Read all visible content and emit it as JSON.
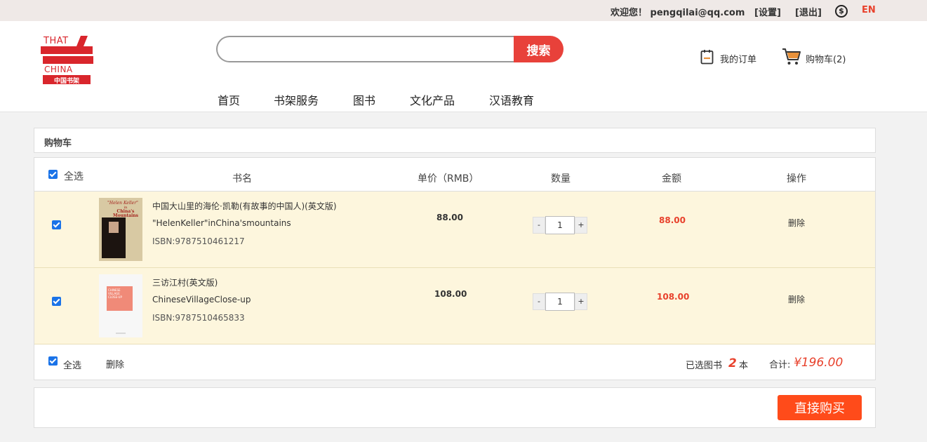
{
  "topbar": {
    "welcome": "欢迎您！ pengqilai@qq.com",
    "settings": "[设置]",
    "logout": "[退出]",
    "currency_icon": "dollar-circle-icon",
    "currency_symbol": "$",
    "language": "EN"
  },
  "logo": {
    "line1": "THAT",
    "line2": "CHINA",
    "line3": "中国书架"
  },
  "search": {
    "placeholder": "",
    "button": "搜索"
  },
  "header_links": {
    "orders": "我的订单",
    "cart": "购物车(2)"
  },
  "nav": [
    "首页",
    "书架服务",
    "图书",
    "文化产品",
    "汉语教育"
  ],
  "cart": {
    "title": "购物车",
    "columns": {
      "select_all": "全选",
      "book": "书名",
      "unit_price": "单价（RMB）",
      "quantity": "数量",
      "amount": "金额",
      "action": "操作"
    },
    "items": [
      {
        "title_cn": "中国大山里的海伦·凯勒(有故事的中国人)(英文版)",
        "title_en": "\"HelenKeller\"inChina'smountains",
        "isbn": "ISBN:9787510461217",
        "price": "88.00",
        "qty": "1",
        "amount": "88.00",
        "action": "删除",
        "cover_text": [
          "\"Helen Keller\"",
          "in",
          "China's",
          "Mountains"
        ]
      },
      {
        "title_cn": "三访江村(英文版)",
        "title_en": "ChineseVillageClose-up",
        "isbn": "ISBN:9787510465833",
        "price": "108.00",
        "qty": "1",
        "amount": "108.00",
        "action": "删除",
        "cover_text": [
          "CHINESE",
          "VILLAGE",
          "CLOSE-UP"
        ]
      }
    ],
    "qty_minus": "-",
    "qty_plus": "+",
    "footer": {
      "select_all": "全选",
      "delete": "删除",
      "selected_prefix": "已选图书",
      "selected_count": "2",
      "selected_suffix": "本",
      "total_label": "合计:",
      "total_value": "¥196.00"
    },
    "buy_button": "直接购买"
  },
  "colors": {
    "accent": "#e8413a",
    "buy": "#ff4b1a",
    "row_bg": "#fdf6dd",
    "price_red": "#e8412c"
  }
}
